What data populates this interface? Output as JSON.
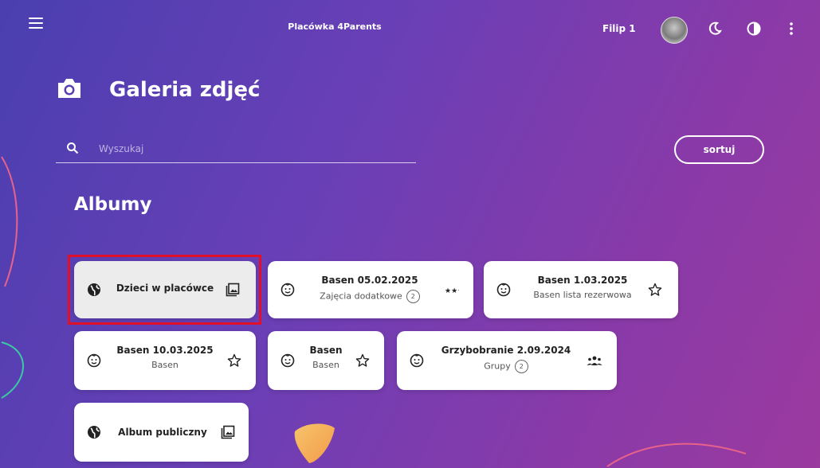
{
  "header": {
    "app_title": "Placówka 4Parents",
    "user_name": "Filip 1",
    "icons": {
      "menu": "hamburger-menu-icon",
      "avatar": "user-avatar",
      "theme": "moon-icon",
      "contrast": "contrast-icon",
      "more": "more-vertical-icon"
    }
  },
  "page": {
    "title": "Galeria zdjęć",
    "title_icon": "camera-icon"
  },
  "search": {
    "placeholder": "Wyszukaj",
    "value": ""
  },
  "sort_label": "sortuj",
  "albums_title": "Albumy",
  "albums": [
    {
      "name": "Dzieci w placówce",
      "subtitle": "",
      "lead_icon": "globe-icon",
      "trail_icon": "gallery-icon",
      "selected": true
    },
    {
      "name": "Basen 05.02.2025",
      "subtitle": "Zajęcia dodatkowe",
      "badge": "2",
      "lead_icon": "child-face-icon",
      "trail_icon": "stars-icon"
    },
    {
      "name": "Basen 1.03.2025",
      "subtitle": "Basen lista rezerwowa",
      "lead_icon": "child-face-icon",
      "trail_icon": "star-icon"
    },
    {
      "name": "Basen 10.03.2025",
      "subtitle": "Basen",
      "lead_icon": "child-face-icon",
      "trail_icon": "star-icon"
    },
    {
      "name": "Basen",
      "subtitle": "Basen",
      "lead_icon": "child-face-icon",
      "trail_icon": "star-icon"
    },
    {
      "name": "Grzybobranie 2.09.2024",
      "subtitle": "Grupy",
      "badge": "2",
      "lead_icon": "child-face-icon",
      "trail_icon": "groups-icon"
    },
    {
      "name": "Album publiczny",
      "subtitle": "",
      "lead_icon": "globe-icon",
      "trail_icon": "gallery-icon"
    }
  ],
  "colors": {
    "bg_start": "#4a3fb0",
    "bg_end": "#9b3a9f",
    "card": "#ffffff",
    "card_selected": "#ececec",
    "highlight": "#e0102a"
  }
}
